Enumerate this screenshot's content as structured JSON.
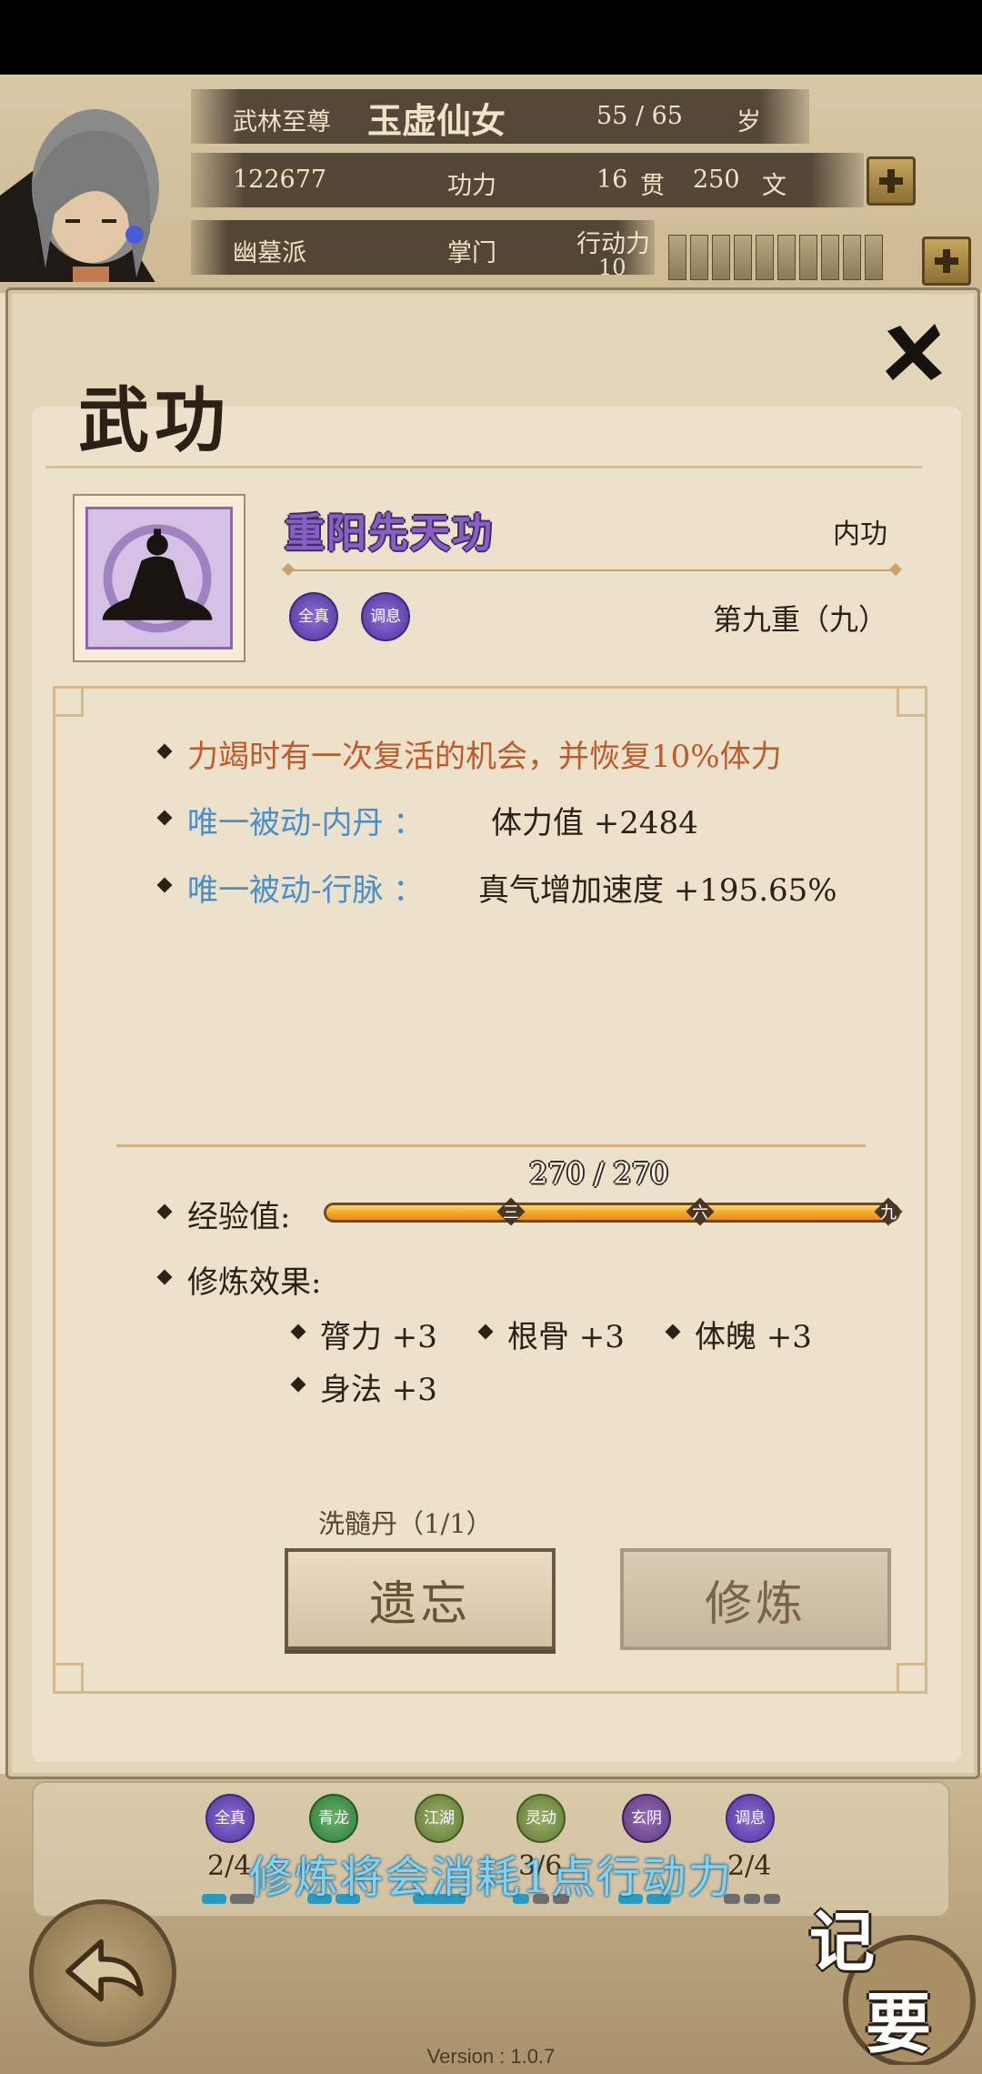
{
  "header": {
    "title_rank": "武林至尊",
    "char_name": "玉虚仙女",
    "age": "55 / 65",
    "age_unit": "岁",
    "power_value": "122677",
    "power_label": "功力",
    "money_guan": "16",
    "money_guan_unit": "贯",
    "money_wen": "250",
    "money_wen_unit": "文",
    "sect": "幽墓派",
    "position": "掌门",
    "energy_label": "行动力",
    "energy_value": "10"
  },
  "panel": {
    "title": "武功",
    "skill_name": "重阳先天功",
    "skill_type": "内功",
    "skill_level": "第九重（九）",
    "badges": [
      "全真",
      "调息"
    ],
    "effects": [
      {
        "text": "力竭时有一次复活的机会，并恢复10%体力"
      },
      {
        "label": "唯一被动-内丹 ：",
        "value": "体力值 +2484"
      },
      {
        "label": "唯一被动-行脉 ：",
        "value": "真气增加速度 +195.65%"
      }
    ],
    "exp_label": "经验值:",
    "exp_value": "270 / 270",
    "exp_progress": 1.0,
    "exp_marks": [
      "三",
      "六",
      "九"
    ],
    "training_title": "修炼效果:",
    "attributes": [
      "膂力 +3",
      "根骨 +3",
      "体魄 +3",
      "身法 +3"
    ],
    "pill_note": "洗髓丹（1/1）",
    "forget_button": "遗忘",
    "train_button": "修炼"
  },
  "bottom": {
    "categories": [
      {
        "badge": "全真",
        "count": "2/4",
        "pips_on": 2,
        "pips_total": 2,
        "color": "#5e3fb0"
      },
      {
        "badge": "青龙",
        "count": "",
        "pips_on": 2,
        "pips_total": 2,
        "color": "#3a8a42"
      },
      {
        "badge": "江湖",
        "count": "",
        "pips_on": 1,
        "pips_total": 1,
        "color": "#6e8a3a"
      },
      {
        "badge": "灵动",
        "count": "3/6",
        "pips_on": 1,
        "pips_total": 3,
        "color": "#6e8a3a"
      },
      {
        "badge": "玄阴",
        "count": "",
        "pips_on": 2,
        "pips_total": 2,
        "color": "#6a3e8a"
      },
      {
        "badge": "调息",
        "count": "2/4",
        "pips_on": 0,
        "pips_total": 3,
        "color": "#5e3fb0"
      }
    ],
    "toast": "修炼将会消耗1点行动力",
    "memo_chars": [
      "记",
      "要"
    ],
    "version": "Version : 1.0.7"
  }
}
